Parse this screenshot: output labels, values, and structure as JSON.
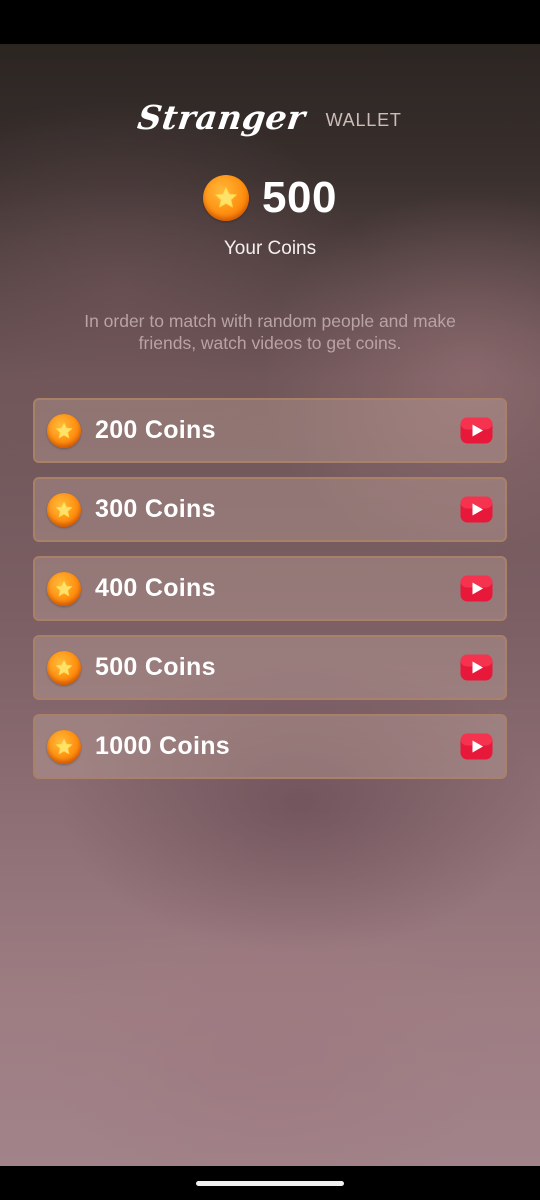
{
  "header": {
    "app_name": "Stranger",
    "section_label": "WALLET"
  },
  "balance": {
    "value": "500",
    "caption": "Your Coins",
    "coin_icon": "star-coin-icon"
  },
  "info": {
    "text": "In order to match with random people and make friends, watch videos to get coins."
  },
  "offers": [
    {
      "label": "200 Coins",
      "action_icon": "video-play-icon"
    },
    {
      "label": "300 Coins",
      "action_icon": "video-play-icon"
    },
    {
      "label": "400 Coins",
      "action_icon": "video-play-icon"
    },
    {
      "label": "500 Coins",
      "action_icon": "video-play-icon"
    },
    {
      "label": "1000 Coins",
      "action_icon": "video-play-icon"
    }
  ],
  "colors": {
    "coin_orange": "#ff8f10",
    "play_red": "#e8183a",
    "offer_border": "#a98068",
    "text_white": "#ffffff",
    "info_text": "#b9a3a5"
  }
}
